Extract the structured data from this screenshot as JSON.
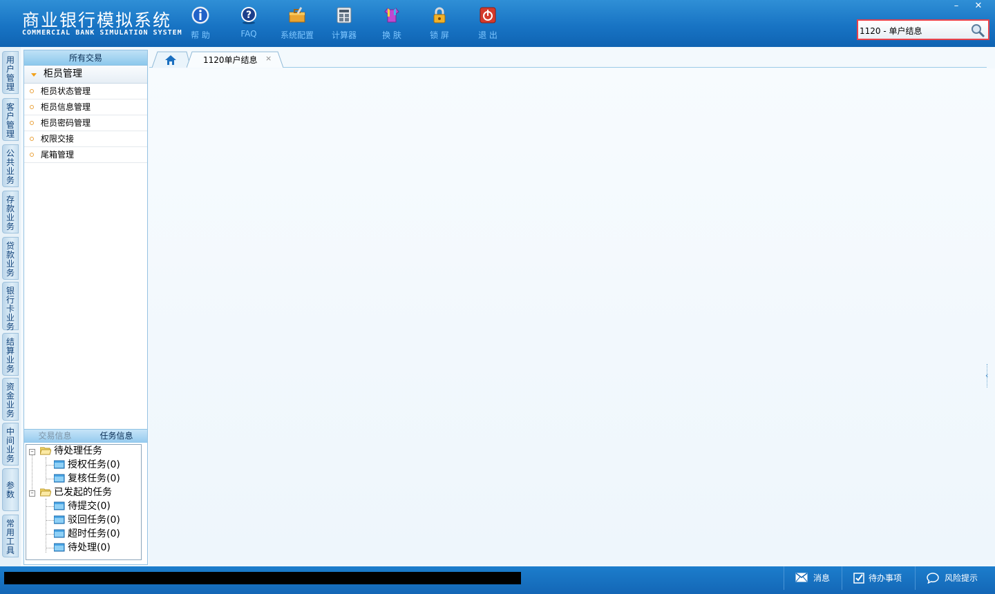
{
  "header": {
    "title_cn": "商业银行模拟系统",
    "title_en": "COMMERCIAL BANK SIMULATION SYSTEM",
    "toolbar": [
      {
        "label": "帮 助",
        "icon": "info-icon"
      },
      {
        "label": "FAQ",
        "icon": "question-icon"
      },
      {
        "label": "系统配置",
        "icon": "toolbox-icon"
      },
      {
        "label": "计算器",
        "icon": "calculator-icon"
      },
      {
        "label": "换 肤",
        "icon": "shirt-icon"
      },
      {
        "label": "锁 屏",
        "icon": "lock-icon"
      },
      {
        "label": "退 出",
        "icon": "power-icon"
      }
    ],
    "window": {
      "minimize": "–",
      "close": "✕"
    },
    "search": {
      "value": "1120 - 单户结息"
    }
  },
  "vtabs": [
    "用户管理",
    "客户管理",
    "公共业务",
    "存款业务",
    "贷款业务",
    "银行卡业务",
    "结算业务",
    "资金业务",
    "中间业务",
    "参数",
    "常用工具"
  ],
  "sidebar": {
    "header": "所有交易",
    "group": "柜员管理",
    "items": [
      "柜员状态管理",
      "柜员信息管理",
      "柜员密码管理",
      "权限交接",
      "尾箱管理"
    ]
  },
  "info_panel": {
    "tabs": [
      "交易信息",
      "任务信息"
    ],
    "tree": {
      "pending": {
        "label": "待处理任务",
        "children": [
          "授权任务(0)",
          "复核任务(0)"
        ]
      },
      "initiated": {
        "label": "已发起的任务",
        "children": [
          "待提交(0)",
          "驳回任务(0)",
          "超时任务(0)",
          "待处理(0)"
        ]
      }
    }
  },
  "tabs": {
    "open_tab": "1120单户结息",
    "close_symbol": "×"
  },
  "statusbar": {
    "message": "消息",
    "todo": "待办事项",
    "risk": "风险提示"
  },
  "colors": {
    "header": "#1874c4",
    "toolbar_label": "#7ec6ff",
    "search_border": "#e8424a",
    "accent_orange": "#f2a11a"
  }
}
